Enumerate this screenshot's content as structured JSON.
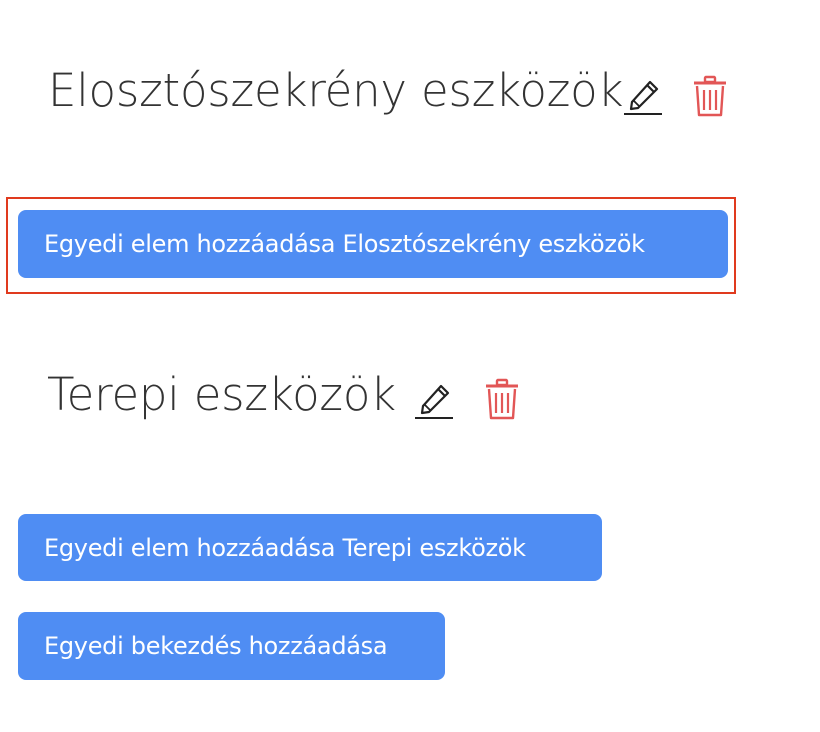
{
  "sections": [
    {
      "title": "Elosztószekrény eszközök",
      "add_item_button": "Egyedi elem hozzáadása Elosztószekrény eszközök"
    },
    {
      "title": "Terepi eszközök",
      "add_item_button": "Egyedi elem hozzáadása Terepi eszközök"
    }
  ],
  "add_paragraph_button": "Egyedi bekezdés hozzáadása",
  "icons": {
    "edit": "pencil-icon",
    "delete": "trash-icon"
  },
  "colors": {
    "button_bg": "#4f8df3",
    "delete_icon": "#e25656",
    "highlight": "#e03a1e"
  }
}
